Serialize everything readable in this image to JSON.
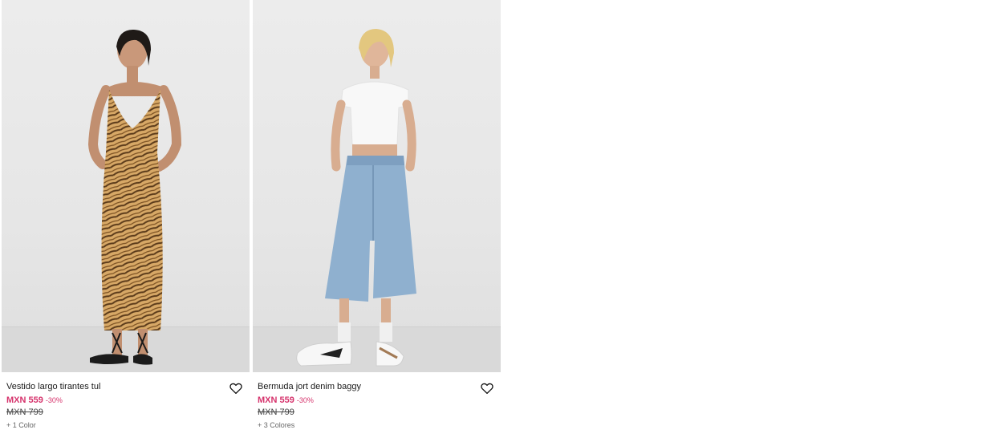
{
  "products": [
    {
      "name": "Vestido largo tirantes tul",
      "price": "MXN 559",
      "discount": "-30%",
      "old_price": "MXN 799",
      "colors": "+ 1 Color",
      "image_alt": "tiger-print tulle dress model"
    },
    {
      "name": "Bermuda jort denim baggy",
      "price": "MXN 559",
      "discount": "-30%",
      "old_price": "MXN 799",
      "colors": "+ 3 Colores",
      "image_alt": "baggy denim jort model"
    }
  ],
  "colors": {
    "sale_price": "#d6336c",
    "text": "#1a1a1a",
    "photo_bg": "#e8e8e8"
  },
  "icons": {
    "favorite": "heart-outline-icon"
  }
}
